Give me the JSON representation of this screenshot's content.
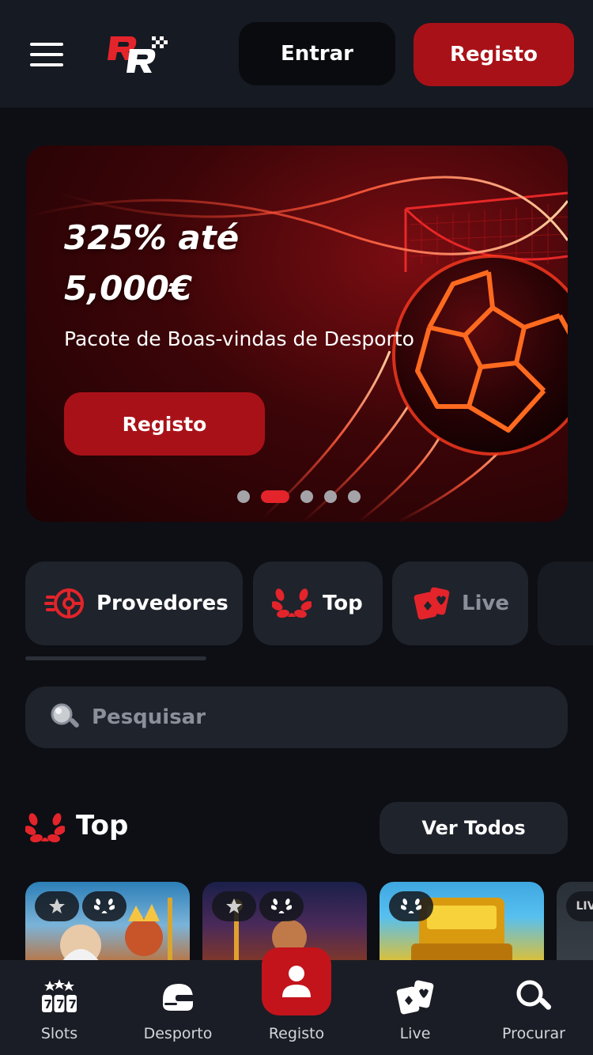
{
  "header": {
    "logo_text": "RR",
    "login_label": "Entrar",
    "register_label": "Registo"
  },
  "banner": {
    "bonus_line1": "325% até",
    "bonus_line2": "5,000€",
    "subtitle": "Pacote de Boas-vindas de Desporto",
    "cta_label": "Registo",
    "slides_count": 5,
    "active_slide": 1
  },
  "categories": [
    {
      "label": "Provedores",
      "icon": "speed-wheel-icon"
    },
    {
      "label": "Top",
      "icon": "laurel-icon"
    },
    {
      "label": "Live",
      "icon": "cards-icon"
    }
  ],
  "search": {
    "placeholder": "Pesquisar"
  },
  "top_section": {
    "title": "Top",
    "view_all_label": "Ver Todos"
  },
  "games": [
    {
      "badges": [
        "drops-wins-badge",
        "laurel-badge"
      ]
    },
    {
      "badges": [
        "drops-wins-badge",
        "laurel-badge"
      ]
    },
    {
      "badges": [
        "laurel-badge"
      ]
    },
    {
      "badges": [
        "live-badge"
      ],
      "badge_text": "LIV"
    }
  ],
  "bottom_nav": [
    {
      "label": "Slots",
      "icon": "slot-777-icon"
    },
    {
      "label": "Desporto",
      "icon": "helmet-icon"
    },
    {
      "label": "Registo",
      "icon": "user-icon"
    },
    {
      "label": "Live",
      "icon": "cards-icon"
    },
    {
      "label": "Procurar",
      "icon": "search-icon"
    }
  ],
  "colors": {
    "accent": "#a91118",
    "accent_bright": "#e3242b",
    "background": "#0d0f14",
    "surface": "#1f232c"
  }
}
